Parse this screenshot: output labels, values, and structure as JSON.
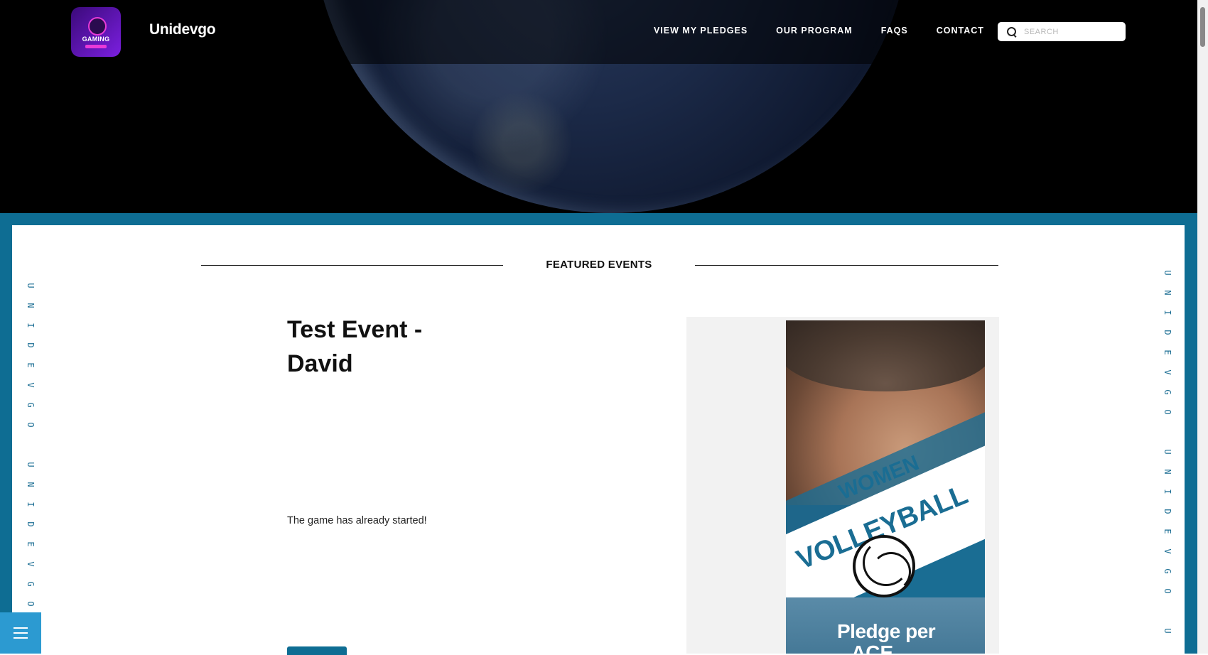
{
  "header": {
    "brand": "Unidevgo",
    "logo_text": "GAMING",
    "nav": [
      {
        "label": "VIEW MY PLEDGES"
      },
      {
        "label": "OUR PROGRAM"
      },
      {
        "label": "FAQS"
      },
      {
        "label": "CONTACT"
      }
    ],
    "search": {
      "placeholder": "SEARCH"
    }
  },
  "side_text": {
    "left": "UNIDEVGOUNIDEVGOU",
    "right": "UNIDEVGOUNIDEVGOU"
  },
  "featured": {
    "heading": "FEATURED EVENTS"
  },
  "event": {
    "title": "Test Event - David",
    "status": "The game has already started!"
  },
  "poster": {
    "line1": "WOMEN",
    "line2": "VOLLEYBALL",
    "line3": "Pledge per",
    "line4": "ACE"
  },
  "colors": {
    "accent": "#0e6d93",
    "menu_button": "#2c9ad1"
  }
}
